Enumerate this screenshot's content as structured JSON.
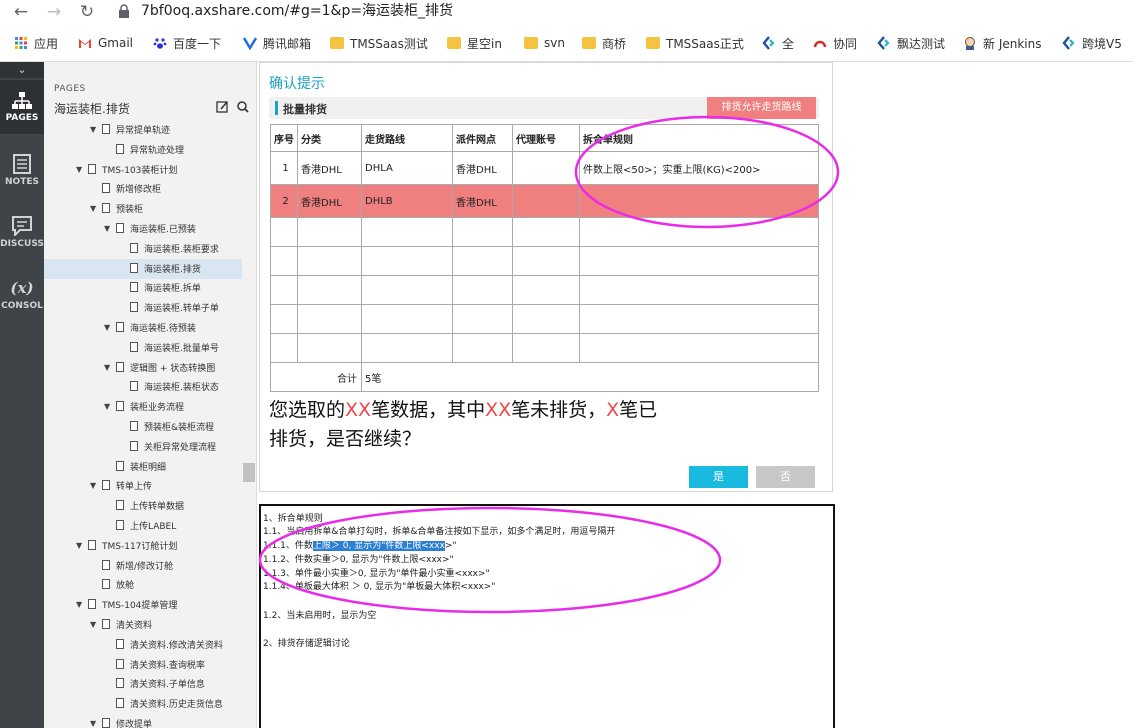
{
  "browser": {
    "url": "7bf0oq.axshare.com/#g=1&p=海运装柜_排货",
    "bookmarks": [
      {
        "label": "应用",
        "icon": "apps-grid-icon"
      },
      {
        "label": "Gmail",
        "icon": "gmail-icon"
      },
      {
        "label": "百度一下",
        "icon": "baidu-paw-icon"
      },
      {
        "label": "腾讯邮箱",
        "icon": "tencent-mail-icon"
      },
      {
        "label": "TMSSaas测试",
        "icon": "folder-icon"
      },
      {
        "label": "星空in",
        "icon": "folder-icon"
      },
      {
        "label": "svn",
        "icon": "folder-icon"
      },
      {
        "label": "商桥",
        "icon": "folder-icon"
      },
      {
        "label": "TMSSaas正式",
        "icon": "folder-icon"
      },
      {
        "label": "全",
        "icon": "diamond-icon"
      },
      {
        "label": "协同",
        "icon": "gauge-icon"
      },
      {
        "label": "飘达测试",
        "icon": "diamond-icon"
      },
      {
        "label": "新 Jenkins",
        "icon": "jenkins-icon"
      },
      {
        "label": "跨境V5",
        "icon": "diamond-icon"
      }
    ]
  },
  "rail": {
    "pages": "PAGES",
    "notes": "NOTES",
    "discuss": "DISCUSS",
    "console": "CONSOL",
    "console_glyph": "(x)"
  },
  "pages_panel": {
    "label": "PAGES",
    "title": "海运装柜.排货",
    "tree": [
      {
        "label": "异常提单轨迹",
        "indent": 4,
        "arrow": true,
        "selected": false
      },
      {
        "label": "异常轨迹处理",
        "indent": 5,
        "arrow": false,
        "selected": false
      },
      {
        "label": "TMS-103装柜计划",
        "indent": 3,
        "arrow": true,
        "selected": false
      },
      {
        "label": "新增修改柜",
        "indent": 4,
        "arrow": false,
        "selected": false
      },
      {
        "label": "预装柜",
        "indent": 4,
        "arrow": true,
        "selected": false
      },
      {
        "label": "海运装柜.已预装",
        "indent": 5,
        "arrow": true,
        "selected": false
      },
      {
        "label": "海运装柜.装柜要求",
        "indent": 6,
        "arrow": false,
        "selected": false
      },
      {
        "label": "海运装柜.排货",
        "indent": 6,
        "arrow": false,
        "selected": true
      },
      {
        "label": "海运装柜.拆单",
        "indent": 6,
        "arrow": false,
        "selected": false
      },
      {
        "label": "海运装柜.转单子单",
        "indent": 6,
        "arrow": false,
        "selected": false
      },
      {
        "label": "海运装柜.待预装",
        "indent": 5,
        "arrow": true,
        "selected": false
      },
      {
        "label": "海运装柜.批量单号",
        "indent": 6,
        "arrow": false,
        "selected": false
      },
      {
        "label": "逻辑图 + 状态转换图",
        "indent": 5,
        "arrow": true,
        "selected": false
      },
      {
        "label": "海运装柜.装柜状态",
        "indent": 6,
        "arrow": false,
        "selected": false
      },
      {
        "label": "装柜业务流程",
        "indent": 5,
        "arrow": true,
        "selected": false
      },
      {
        "label": "预装柜&装柜流程",
        "indent": 6,
        "arrow": false,
        "selected": false
      },
      {
        "label": "关柜异常处理流程",
        "indent": 6,
        "arrow": false,
        "selected": false
      },
      {
        "label": "装柜明细",
        "indent": 5,
        "arrow": false,
        "selected": false
      },
      {
        "label": "转单上传",
        "indent": 4,
        "arrow": true,
        "selected": false
      },
      {
        "label": "上传转单数据",
        "indent": 5,
        "arrow": false,
        "selected": false
      },
      {
        "label": "上传LABEL",
        "indent": 5,
        "arrow": false,
        "selected": false
      },
      {
        "label": "TMS-117订舱计划",
        "indent": 3,
        "arrow": true,
        "selected": false
      },
      {
        "label": "新增/修改订舱",
        "indent": 4,
        "arrow": false,
        "selected": false
      },
      {
        "label": "放舱",
        "indent": 4,
        "arrow": false,
        "selected": false
      },
      {
        "label": "TMS-104提单管理",
        "indent": 3,
        "arrow": true,
        "selected": false
      },
      {
        "label": "清关资料",
        "indent": 4,
        "arrow": true,
        "selected": false
      },
      {
        "label": "清关资料.修改清关资料",
        "indent": 5,
        "arrow": false,
        "selected": false
      },
      {
        "label": "清关资料.查询税率",
        "indent": 5,
        "arrow": false,
        "selected": false
      },
      {
        "label": "清关资料.子单信息",
        "indent": 5,
        "arrow": false,
        "selected": false
      },
      {
        "label": "清关资料.历史走货信息",
        "indent": 5,
        "arrow": false,
        "selected": false
      },
      {
        "label": "修改提单",
        "indent": 4,
        "arrow": true,
        "selected": false
      }
    ]
  },
  "dialog": {
    "title": "确认提示",
    "section_title": "批量排货",
    "route_button": "排货允许走货路线",
    "columns": [
      "序号",
      "分类",
      "走货路线",
      "派件网点",
      "代理账号",
      "拆合单规则"
    ],
    "rows": [
      [
        "1",
        "香港DHL",
        "DHLA",
        "香港DHL",
        "",
        "件数上限<50>；实重上限(KG)<200>"
      ],
      [
        "2",
        "香港DHL",
        "DHLB",
        "香港DHL",
        "",
        ""
      ]
    ],
    "empty_rows": 5,
    "total_label": "合计",
    "total_value": "5笔",
    "question": {
      "p1": "您选取的",
      "x1": "XX",
      "p2": "笔数据，其中",
      "x2": "XX",
      "p3": "笔未排货，",
      "x3": "X",
      "p4": "笔已排货，是否继续？"
    },
    "yes": "是",
    "no": "否"
  },
  "notes": {
    "lines": [
      "1、拆合单规则",
      "1.1、当启用拆单&合单打勾时，拆单&合单备注按如下显示，如多个满足时，用逗号隔开",
      "1.1.1、件数",
      "1.1.2、件数实重＞0, 显示为\"件数上限<xxx>\"",
      "1.1.3、单件最小实重＞0, 显示为\"单件最小实重<xxx>\"",
      "1.1.4、单板最大体积 ＞ 0, 显示为\"单板最大体积<xxx>\"",
      "1.2、当未启用时，显示为空",
      "2、排货存储逻辑讨论"
    ],
    "highlight": "上限＞ 0, 显示为\"件数上限<xxx",
    "line3_tail": ">\""
  },
  "colors": {
    "accent": "#1aa4c8",
    "highlight_row": "#f08080",
    "annotation": "#e82ce8",
    "rail": "#3f4448"
  }
}
